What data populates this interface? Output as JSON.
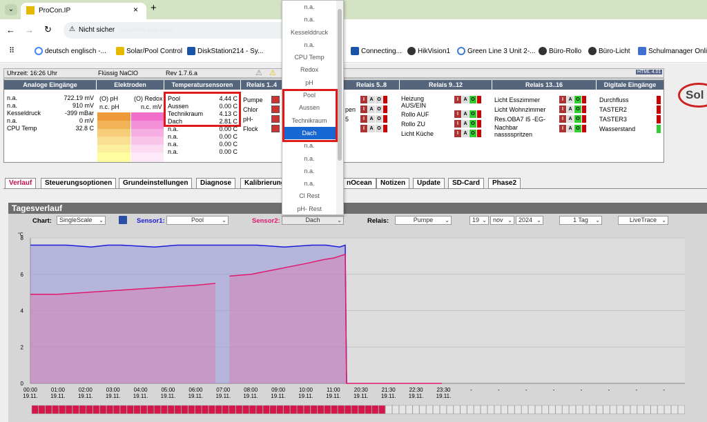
{
  "browser": {
    "tab_title": "ProCon.IP",
    "security": "Nicht sicher",
    "url": "··········· ····· ·····"
  },
  "bookmarks": [
    "deutsch englisch -...",
    "Solar/Pool Control",
    "DiskStation214 - Sy...",
    "Connecting...",
    "HikVision1",
    "Green Line 3 Unit 2-...",
    "Büro-Rollo",
    "Büro-Licht",
    "Schulmanager Online"
  ],
  "header": {
    "time": "Uhrzeit: 16:26 Uhr",
    "product": "Flüssig NaClO",
    "rev": "Rev 1.7.6.a",
    "badge": "HTML 4.01"
  },
  "sections": {
    "analog": "Analoge Eingänge",
    "elec": "Elektroden",
    "temp": "Temperatursensoren",
    "relais1": "Relais 1..4",
    "relais5": "Relais 5..8",
    "relais9": "Relais 9..12",
    "relais13": "Relais 13..16",
    "digital": "Digitale Eingänge"
  },
  "analog": [
    [
      "n.a.",
      "722.19 mV"
    ],
    [
      "n.a.",
      "910 mV"
    ],
    [
      "Kesseldruck",
      "-399 mBar"
    ],
    [
      "n.a.",
      "0 mV"
    ],
    [
      "CPU Temp",
      "32.8 C"
    ]
  ],
  "electrodes": {
    "ph": "(O) pH",
    "redox": "(O) Redox",
    "ph_nc": "n.c. pH",
    "redox_nc": "n.c. mV"
  },
  "temps": [
    [
      "Pool",
      "4.44 C"
    ],
    [
      "Aussen",
      "0.00 C"
    ],
    [
      "Technikraum",
      "4.13 C"
    ],
    [
      "Dach",
      "2.81 C"
    ],
    [
      "n.a.",
      "0.00 C"
    ],
    [
      "n.a.",
      "0.00 C"
    ],
    [
      "n.a.",
      "0.00 C"
    ],
    [
      "n.a.",
      "0.00 C"
    ]
  ],
  "relais1": [
    "Pumpe",
    "Chlor",
    "pH-",
    "Flock"
  ],
  "relais5": [
    "pen",
    "5"
  ],
  "relais9": [
    "Heizung AUS/EIN",
    "Rollo AUF",
    "Rollo ZU",
    "Licht Küche"
  ],
  "relais13": [
    "Licht Esszimmer",
    "Licht Wohnzimmer",
    "Res.OBA7 I5 -EG-",
    "Nachbar nasssspritzen"
  ],
  "digital": [
    "Durchfluss",
    "TASTER2",
    "TASTER3",
    "Wasserstand"
  ],
  "tabs": [
    "Verlauf",
    "Steuerungsoptionen",
    "Grundeinstellungen",
    "Diagnose",
    "Kalibrierung",
    "nOcean",
    "Notizen",
    "Update",
    "SD-Card",
    "Phase2"
  ],
  "chart_panel": {
    "title": "Tagesverlauf",
    "chart_label": "Chart:",
    "chart_value": "SingleScale",
    "s1_label": "Sensor1:",
    "s1_value": "Pool",
    "s2_label": "Sensor2:",
    "s2_value": "Dach",
    "rel_label": "Relais:",
    "rel_value": "Pumpe",
    "day": "19",
    "month": "nov",
    "year": "2024",
    "range": "1 Tag",
    "mode": "LiveTrace"
  },
  "dropdown": [
    "n.a.",
    "n.a.",
    "Kesselddruck",
    "n.a.",
    "CPU Temp",
    "Redox",
    "pH",
    "Pool",
    "Aussen",
    "Technikraum",
    "Dach",
    "n.a.",
    "n.a.",
    "n.a.",
    "n.a.",
    "Cl Rest",
    "pH- Rest"
  ],
  "chart_data": {
    "type": "area",
    "ylabel": "°C",
    "ylim": [
      0,
      8
    ],
    "yticks": [
      0,
      2,
      4,
      6,
      8
    ],
    "xticks": [
      "00:00",
      "01:00",
      "02:00",
      "03:00",
      "04:00",
      "05:00",
      "06:00",
      "07:00",
      "08:00",
      "09:00",
      "10:00",
      "11:00",
      "20:30",
      "21:30",
      "22:30",
      "23:30",
      "-",
      "-",
      "-",
      "-",
      "-",
      "-",
      "-",
      "-"
    ],
    "xdate": "19.11.",
    "series": [
      {
        "name": "Pool",
        "color": "#1a1adc",
        "x": [
          0,
          0.3,
          1.3,
          2.2,
          2.8,
          3.3,
          4.5,
          5.3,
          6.2,
          7.2,
          8.2,
          9.2,
          10.2,
          10.7,
          11.2,
          11.4,
          11.45
        ],
        "y": [
          7.6,
          7.6,
          7.6,
          7.5,
          7.6,
          7.6,
          7.5,
          7.6,
          7.6,
          7.6,
          7.6,
          7.5,
          7.6,
          7.6,
          7.5,
          7.6,
          0
        ]
      },
      {
        "name": "Dach",
        "color": "#e0196e",
        "x": [
          0,
          1.0,
          2.0,
          3.0,
          4.0,
          5.0,
          6.0,
          6.7,
          6.71,
          7.2,
          7.21,
          8.0,
          9.0,
          10.0,
          10.6,
          11.0,
          11.4,
          11.45,
          12,
          14.9
        ],
        "y": [
          4.9,
          4.9,
          5.0,
          5.1,
          5.2,
          5.3,
          5.4,
          5.5,
          null,
          null,
          5.9,
          6.0,
          6.3,
          6.6,
          6.8,
          6.9,
          7.1,
          0,
          0,
          0
        ]
      }
    ]
  }
}
